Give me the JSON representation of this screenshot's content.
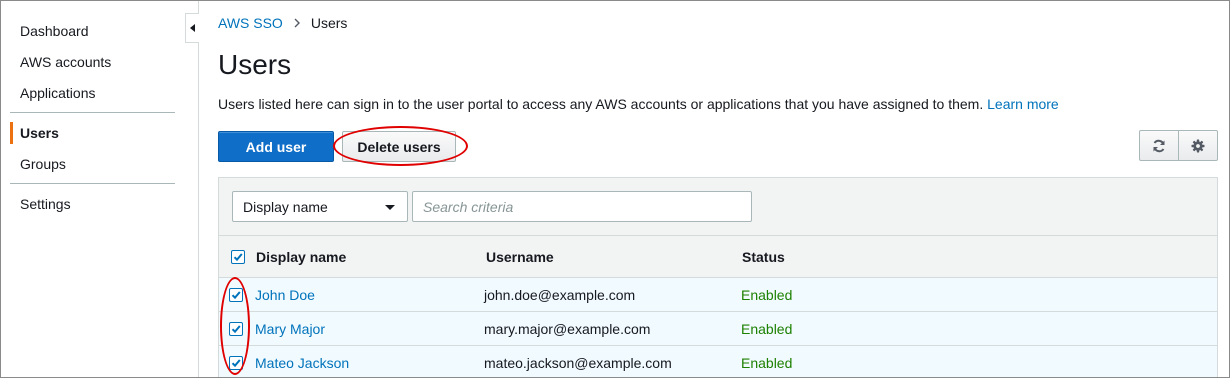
{
  "sidebar": {
    "items": [
      {
        "label": "Dashboard"
      },
      {
        "label": "AWS accounts"
      },
      {
        "label": "Applications"
      },
      {
        "label": "Users",
        "active": true
      },
      {
        "label": "Groups"
      },
      {
        "label": "Settings"
      }
    ]
  },
  "breadcrumb": {
    "parent": "AWS SSO",
    "separator": ">",
    "current": "Users"
  },
  "page": {
    "title": "Users",
    "description": "Users listed here can sign in to the user portal to access any AWS accounts or applications that you have assigned to them.",
    "learn_more": "Learn more"
  },
  "toolbar": {
    "add_user_label": "Add user",
    "delete_users_label": "Delete users"
  },
  "filter": {
    "selected": "Display name",
    "search_placeholder": "Search criteria"
  },
  "table": {
    "columns": [
      "Display name",
      "Username",
      "Status"
    ],
    "rows": [
      {
        "display_name": "John Doe",
        "username": "john.doe@example.com",
        "status": "Enabled",
        "checked": true
      },
      {
        "display_name": "Mary Major",
        "username": "mary.major@example.com",
        "status": "Enabled",
        "checked": true
      },
      {
        "display_name": "Mateo Jackson",
        "username": "mateo.jackson@example.com",
        "status": "Enabled",
        "checked": true
      }
    ]
  },
  "colors": {
    "accent": "#0f6ec7",
    "link": "#0073bb",
    "status_enabled": "#1d8102",
    "active_nav": "#ec7211",
    "annotation": "#e00000"
  }
}
